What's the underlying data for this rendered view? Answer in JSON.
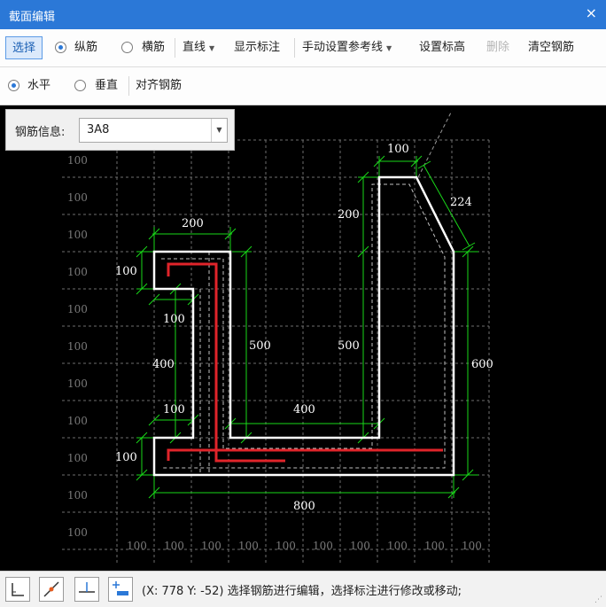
{
  "window": {
    "title": "截面编辑",
    "close": "×"
  },
  "toolbar": {
    "select": "选择",
    "longitudinal": "纵筋",
    "stirrup": "横筋",
    "line": "直线",
    "show_dims": "显示标注",
    "manual_ref": "手动设置参考线",
    "set_elev": "设置标高",
    "delete": "删除",
    "clear": "清空钢筋"
  },
  "toolbar2": {
    "horizontal": "水平",
    "vertical": "垂直",
    "align": "对齐钢筋"
  },
  "rebar_info": {
    "label": "钢筋信息:",
    "value": "3A8"
  },
  "grid": {
    "row_labels": [
      "100",
      "100",
      "100",
      "100",
      "100",
      "100",
      "100",
      "100",
      "100",
      "100",
      "100"
    ],
    "col_labels": [
      "100",
      "100",
      "100",
      "100",
      "100",
      "100",
      "100",
      "100",
      "100",
      "100"
    ]
  },
  "dims": {
    "top_width": "200",
    "left_step": "100",
    "left_notch": "100",
    "left_height": "400",
    "left_lower_notch": "100",
    "bottom_left": "100",
    "inner_left": "500",
    "inner_bottom": "400",
    "inner_right": "500",
    "right_top": "200",
    "right_width": "100",
    "slope": "224",
    "right_height": "600",
    "total_width": "800"
  },
  "status": {
    "coords": "(X: 778 Y: -52)",
    "message": "选择钢筋进行编辑，选择标注进行修改或移动;"
  },
  "colors": {
    "titlebar": "#2b78d7",
    "outline": "#ffffff",
    "rebar": "#e0242a",
    "dimension": "#19d919",
    "grid": "#7a7a7a",
    "canvas": "#000000"
  },
  "icons": [
    "close-icon",
    "caret-down-icon",
    "chevron-down-icon",
    "ortho-icon",
    "snap-icon",
    "perpendicular-icon",
    "add-point-icon",
    "resize-grip-icon"
  ]
}
